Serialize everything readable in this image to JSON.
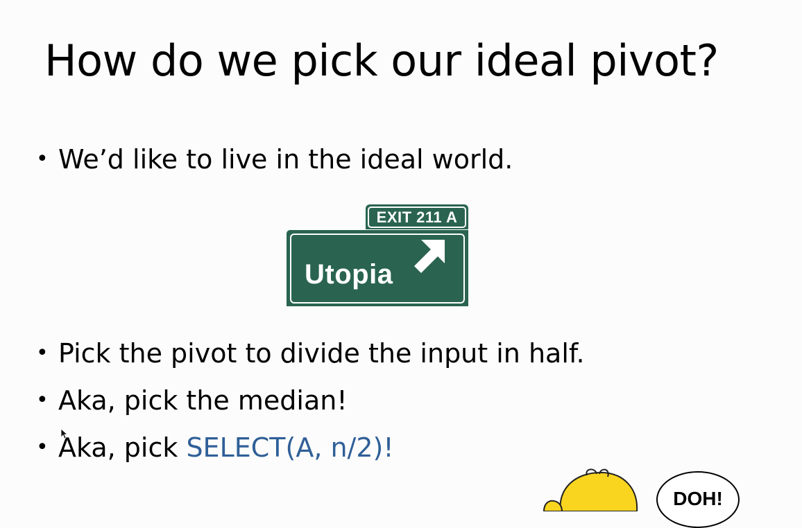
{
  "slide": {
    "title": "How do we pick our ideal pivot?",
    "bullet_char": "•",
    "bullets": [
      {
        "text": "We’d like to live in the ideal world."
      },
      {
        "text": "Pick the pivot to divide the input in half."
      },
      {
        "text": "Aka, pick the median!"
      },
      {
        "prefix": "Aka, pick ",
        "highlight": "SELECT(A, n/2)!"
      }
    ],
    "highlight_color": "#2f5f97"
  },
  "sign": {
    "exit_label": "EXIT 211 A",
    "destination": "Utopia",
    "color": "#2a6450",
    "icon": "arrow-up-right-icon"
  },
  "cartoon": {
    "speech": "DOH!",
    "icon": "homer-head-icon"
  }
}
